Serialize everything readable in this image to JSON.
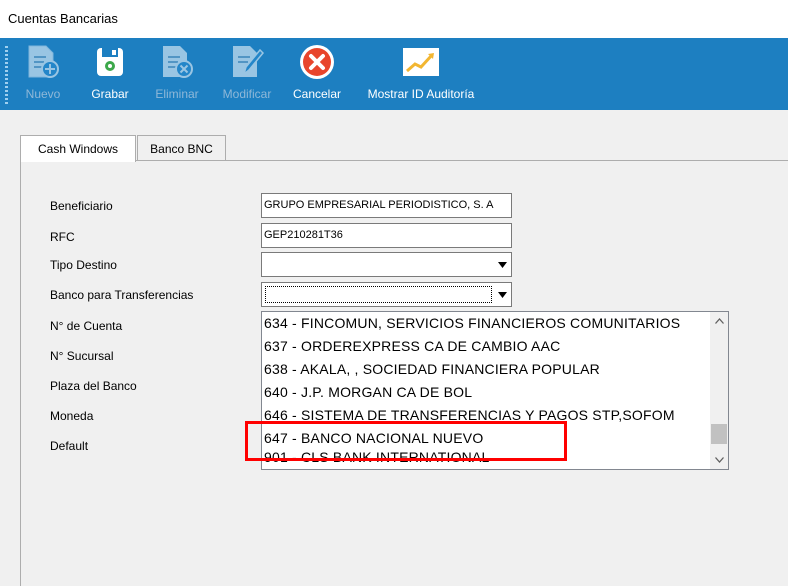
{
  "window": {
    "title": "Cuentas Bancarias"
  },
  "toolbar": {
    "buttons": [
      {
        "label": "Nuevo",
        "icon": "new-doc-icon",
        "enabled": false
      },
      {
        "label": "Grabar",
        "icon": "save-icon",
        "enabled": true
      },
      {
        "label": "Eliminar",
        "icon": "delete-doc-icon",
        "enabled": false
      },
      {
        "label": "Modificar",
        "icon": "edit-doc-icon",
        "enabled": false
      },
      {
        "label": "Cancelar",
        "icon": "cancel-icon",
        "enabled": true
      },
      {
        "label": "Mostrar ID Auditoría",
        "icon": "chart-icon",
        "enabled": true
      }
    ]
  },
  "tabs": [
    {
      "label": "Cash Windows",
      "active": true
    },
    {
      "label": "Banco BNC",
      "active": false
    }
  ],
  "form": {
    "labels": {
      "beneficiario": "Beneficiario",
      "rfc": "RFC",
      "tipo_destino": "Tipo Destino",
      "banco_transferencias": "Banco para Transferencias",
      "num_cuenta": "N° de Cuenta",
      "num_sucursal": "N° Sucursal",
      "plaza": "Plaza del Banco",
      "moneda": "Moneda",
      "default": "Default"
    },
    "values": {
      "beneficiario": "GRUPO EMPRESARIAL PERIODISTICO, S. A",
      "rfc": "GEP210281T36",
      "tipo_destino": "",
      "banco_transferencias": ""
    }
  },
  "dropdown": {
    "items": [
      "634  -  FINCOMUN, SERVICIOS FINANCIEROS COMUNITARIOS",
      "637  -  ORDEREXPRESS CA DE CAMBIO AAC",
      "638  -  AKALA, , SOCIEDAD FINANCIERA POPULAR",
      "640  -  J.P. MORGAN CA DE BOL",
      "646  -  SISTEMA DE TRANSFERENCIAS Y PAGOS STP,SOFOM",
      "647  -  BANCO NACIONAL NUEVO",
      "901  -  CLS BANK INTERNATIONAL"
    ],
    "highlighted_index": 5
  },
  "colors": {
    "toolbar_bg": "#1d7fc1",
    "highlight_border": "#ff0000",
    "panel_bg": "#f0f0f0"
  }
}
